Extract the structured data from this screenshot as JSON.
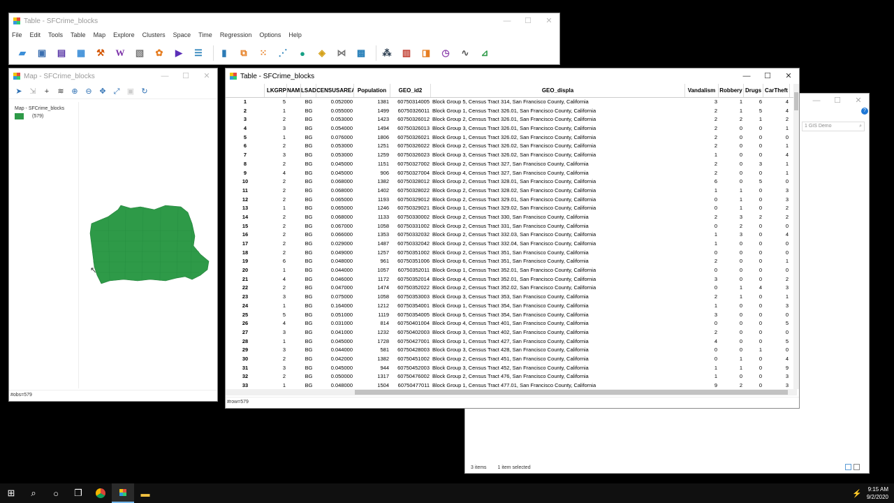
{
  "main_window": {
    "title": "Table - SFCrime_blocks",
    "menus": [
      "File",
      "Edit",
      "Tools",
      "Table",
      "Map",
      "Explore",
      "Clusters",
      "Space",
      "Time",
      "Regression",
      "Options",
      "Help"
    ]
  },
  "map_window": {
    "title": "Map - SFCrime_blocks",
    "legend_title": "Map - SFCrime_blocks",
    "legend_count": "(579)",
    "legend_color": "#2e9a48",
    "status": "#obs=579"
  },
  "table_window": {
    "title": "Table - SFCrime_blocks",
    "status": "#row=579",
    "columns": [
      "",
      "LKGRP",
      "NAMI",
      "LSAD",
      "CENSUSAREA",
      "Population",
      "GEO_id2",
      "GEO_displa",
      "Vandalism",
      "Robbery",
      "Drugs",
      "CarTheft"
    ],
    "rows": [
      [
        "1",
        "5",
        "BG",
        "0.052000",
        "1381",
        "60750314005",
        "Block Group 5, Census Tract 314, San Francisco County, California",
        "3",
        "1",
        "6",
        "4"
      ],
      [
        "2",
        "1",
        "BG",
        "0.055000",
        "1499",
        "60750326011",
        "Block Group 1, Census Tract 326.01, San Francisco County, California",
        "2",
        "1",
        "5",
        "4"
      ],
      [
        "3",
        "2",
        "BG",
        "0.053000",
        "1423",
        "60750326012",
        "Block Group 2, Census Tract 326.01, San Francisco County, California",
        "2",
        "2",
        "1",
        "2"
      ],
      [
        "4",
        "3",
        "BG",
        "0.054000",
        "1494",
        "60750326013",
        "Block Group 3, Census Tract 326.01, San Francisco County, California",
        "2",
        "0",
        "0",
        "1"
      ],
      [
        "5",
        "1",
        "BG",
        "0.076000",
        "1806",
        "60750326021",
        "Block Group 1, Census Tract 326.02, San Francisco County, California",
        "2",
        "0",
        "0",
        "0"
      ],
      [
        "6",
        "2",
        "BG",
        "0.053000",
        "1251",
        "60750326022",
        "Block Group 2, Census Tract 326.02, San Francisco County, California",
        "2",
        "0",
        "0",
        "1"
      ],
      [
        "7",
        "3",
        "BG",
        "0.053000",
        "1259",
        "60750326023",
        "Block Group 3, Census Tract 326.02, San Francisco County, California",
        "1",
        "0",
        "0",
        "4"
      ],
      [
        "8",
        "2",
        "BG",
        "0.045000",
        "1151",
        "60750327002",
        "Block Group 2, Census Tract 327, San Francisco County, California",
        "2",
        "0",
        "3",
        "1"
      ],
      [
        "9",
        "4",
        "BG",
        "0.045000",
        "906",
        "60750327004",
        "Block Group 4, Census Tract 327, San Francisco County, California",
        "2",
        "0",
        "0",
        "1"
      ],
      [
        "10",
        "2",
        "BG",
        "0.068000",
        "1382",
        "60750328012",
        "Block Group 2, Census Tract 328.01, San Francisco County, California",
        "6",
        "0",
        "5",
        "0"
      ],
      [
        "11",
        "2",
        "BG",
        "0.068000",
        "1402",
        "60750328022",
        "Block Group 2, Census Tract 328.02, San Francisco County, California",
        "1",
        "1",
        "0",
        "3"
      ],
      [
        "12",
        "2",
        "BG",
        "0.065000",
        "1193",
        "60750329012",
        "Block Group 2, Census Tract 329.01, San Francisco County, California",
        "0",
        "1",
        "0",
        "3"
      ],
      [
        "13",
        "1",
        "BG",
        "0.065000",
        "1246",
        "60750329021",
        "Block Group 1, Census Tract 329.02, San Francisco County, California",
        "0",
        "1",
        "0",
        "2"
      ],
      [
        "14",
        "2",
        "BG",
        "0.068000",
        "1133",
        "60750330002",
        "Block Group 2, Census Tract 330, San Francisco County, California",
        "2",
        "3",
        "2",
        "2"
      ],
      [
        "15",
        "2",
        "BG",
        "0.067000",
        "1058",
        "60750331002",
        "Block Group 2, Census Tract 331, San Francisco County, California",
        "0",
        "2",
        "0",
        "0"
      ],
      [
        "16",
        "2",
        "BG",
        "0.066000",
        "1353",
        "60750332032",
        "Block Group 2, Census Tract 332.03, San Francisco County, California",
        "1",
        "3",
        "0",
        "4"
      ],
      [
        "17",
        "2",
        "BG",
        "0.029000",
        "1487",
        "60750332042",
        "Block Group 2, Census Tract 332.04, San Francisco County, California",
        "1",
        "0",
        "0",
        "0"
      ],
      [
        "18",
        "2",
        "BG",
        "0.049000",
        "1257",
        "60750351002",
        "Block Group 2, Census Tract 351, San Francisco County, California",
        "0",
        "0",
        "0",
        "0"
      ],
      [
        "19",
        "6",
        "BG",
        "0.048000",
        "961",
        "60750351006",
        "Block Group 6, Census Tract 351, San Francisco County, California",
        "2",
        "0",
        "0",
        "1"
      ],
      [
        "20",
        "1",
        "BG",
        "0.044000",
        "1057",
        "60750352011",
        "Block Group 1, Census Tract 352.01, San Francisco County, California",
        "0",
        "0",
        "0",
        "0"
      ],
      [
        "21",
        "4",
        "BG",
        "0.046000",
        "1172",
        "60750352014",
        "Block Group 4, Census Tract 352.01, San Francisco County, California",
        "3",
        "0",
        "0",
        "2"
      ],
      [
        "22",
        "2",
        "BG",
        "0.047000",
        "1474",
        "60750352022",
        "Block Group 2, Census Tract 352.02, San Francisco County, California",
        "0",
        "1",
        "4",
        "3"
      ],
      [
        "23",
        "3",
        "BG",
        "0.075000",
        "1058",
        "60750353003",
        "Block Group 3, Census Tract 353, San Francisco County, California",
        "2",
        "1",
        "0",
        "1"
      ],
      [
        "24",
        "1",
        "BG",
        "0.164000",
        "1212",
        "60750354001",
        "Block Group 1, Census Tract 354, San Francisco County, California",
        "1",
        "0",
        "0",
        "3"
      ],
      [
        "25",
        "5",
        "BG",
        "0.051000",
        "1119",
        "60750354005",
        "Block Group 5, Census Tract 354, San Francisco County, California",
        "3",
        "0",
        "0",
        "0"
      ],
      [
        "26",
        "4",
        "BG",
        "0.031000",
        "814",
        "60750401004",
        "Block Group 4, Census Tract 401, San Francisco County, California",
        "0",
        "0",
        "0",
        "5"
      ],
      [
        "27",
        "3",
        "BG",
        "0.041000",
        "1232",
        "60750402003",
        "Block Group 3, Census Tract 402, San Francisco County, California",
        "2",
        "0",
        "0",
        "0"
      ],
      [
        "28",
        "1",
        "BG",
        "0.045000",
        "1728",
        "60750427001",
        "Block Group 1, Census Tract 427, San Francisco County, California",
        "4",
        "0",
        "0",
        "5"
      ],
      [
        "29",
        "3",
        "BG",
        "0.044000",
        "581",
        "60750428003",
        "Block Group 3, Census Tract 428, San Francisco County, California",
        "0",
        "0",
        "1",
        "0"
      ],
      [
        "30",
        "2",
        "BG",
        "0.042000",
        "1382",
        "60750451002",
        "Block Group 2, Census Tract 451, San Francisco County, California",
        "0",
        "1",
        "0",
        "4"
      ],
      [
        "31",
        "3",
        "BG",
        "0.045000",
        "944",
        "60750452003",
        "Block Group 3, Census Tract 452, San Francisco County, California",
        "1",
        "1",
        "0",
        "9"
      ],
      [
        "32",
        "2",
        "BG",
        "0.050000",
        "1317",
        "60750476002",
        "Block Group 2, Census Tract 476, San Francisco County, California",
        "1",
        "0",
        "0",
        "3"
      ],
      [
        "33",
        "1",
        "BG",
        "0.048000",
        "1504",
        "60750477011",
        "Block Group 1, Census Tract 477.01, San Francisco County, California",
        "9",
        "2",
        "0",
        "3"
      ]
    ]
  },
  "explorer": {
    "search_placeholder": "1 GIS Demo",
    "items_count": "3 items",
    "selected": "1 item selected"
  },
  "taskbar": {
    "time": "9:15 AM",
    "date": "9/2/2020"
  }
}
